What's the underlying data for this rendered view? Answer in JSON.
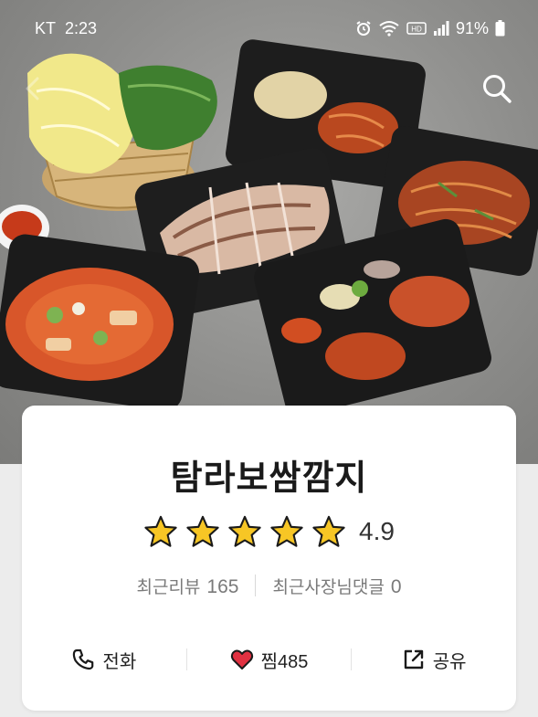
{
  "status_bar": {
    "carrier": "KT",
    "time": "2:23",
    "battery": "91%"
  },
  "header": {
    "search_icon": "search-icon",
    "back_icon": "back-arrow-icon"
  },
  "restaurant": {
    "name": "탐라보쌈깜지",
    "rating": "4.9",
    "stars": 5,
    "star_color": "#F7C625",
    "recent_reviews_label": "최근리뷰",
    "recent_reviews_count": "165",
    "owner_replies_label": "최근사장님댓글",
    "owner_replies_count": "0"
  },
  "actions": {
    "call_label": "전화",
    "like_label": "찜",
    "like_count": "485",
    "share_label": "공유"
  },
  "colors": {
    "heart": "#E03141",
    "text_dark": "#1a1a1a",
    "text_muted": "#7a7a7a"
  }
}
